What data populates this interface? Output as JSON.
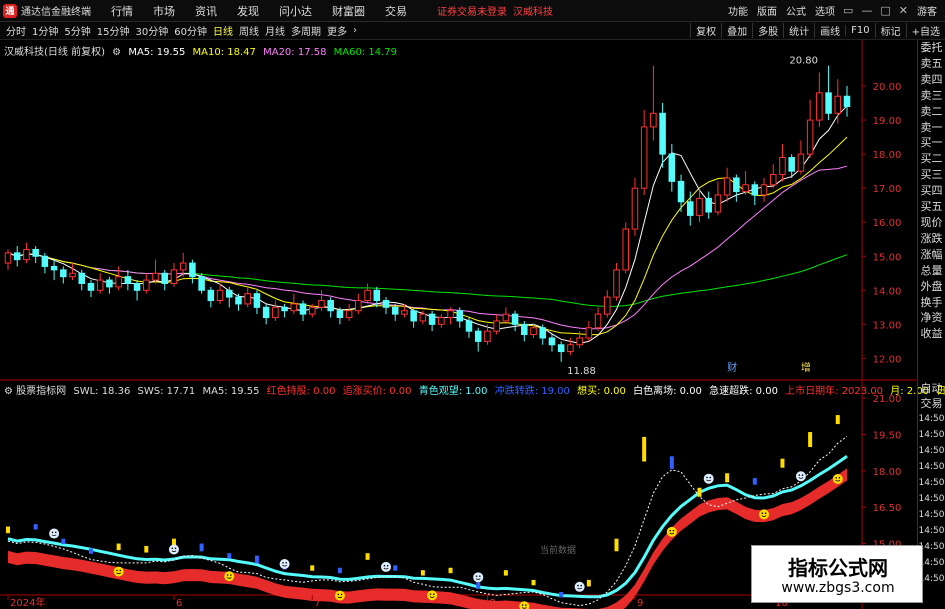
{
  "titlebar": {
    "app_title": "通达信金融终端",
    "logo_glyph": "通",
    "menus": [
      "行情",
      "市场",
      "资讯",
      "发现",
      "问小达",
      "财富圈",
      "交易"
    ],
    "login_notice": "证券交易未登录",
    "stock_name": "汉威科技",
    "right_menus": [
      "功能",
      "版面",
      "公式",
      "选项"
    ],
    "guest": "游客"
  },
  "toolbar": {
    "timeframes": [
      "分时",
      "1分钟",
      "5分钟",
      "15分钟",
      "30分钟",
      "60分钟",
      "日线",
      "周线",
      "月线",
      "多周期",
      "更多"
    ],
    "active_timeframe": "日线",
    "tools": [
      "复权",
      "叠加",
      "多股",
      "统计",
      "画线",
      "F10",
      "标记",
      "+自选"
    ]
  },
  "main_legend": {
    "title": "汉威科技(日线 前复权)",
    "ma5": "MA5: 19.55",
    "ma10": "MA10: 18.47",
    "ma20": "MA20: 17.58",
    "ma60": "MA60: 14.79"
  },
  "main_axis": {
    "ticks": [
      "20.00",
      "19.00",
      "18.00",
      "17.00",
      "16.00",
      "15.00",
      "14.00",
      "13.00",
      "12.00"
    ]
  },
  "main_annotations": {
    "high": "20.80",
    "low": "11.88",
    "marker_cai": "财",
    "marker_zeng": "增"
  },
  "sub_legend": {
    "title": "股票指标网",
    "swl": "SWL: 18.36",
    "sws": "SWS: 17.71",
    "ma5": "MA5: 19.55",
    "red_hold": "红色持股: 0.00",
    "chase": "追涨买价: 0.00",
    "cyan_watch": "青色观望: 1.00",
    "pull_back": "冲跌转跌: 19.00",
    "think_buy": "想买: 0.00",
    "white_leave": "白色离场: 0.00",
    "sharp_drop": "急速超跌: 0.00",
    "list_date": "上市日期年: 2023.00",
    "month": "月: 2.00",
    "day": "日: 17.00"
  },
  "sub_axis": {
    "ticks": [
      "21.00",
      "19.50",
      "18.00",
      "16.50",
      "15.00",
      "13.50"
    ]
  },
  "sub_center_label": "当前数据",
  "date_axis": [
    "2024年",
    "6",
    "7",
    "8",
    "9",
    "10"
  ],
  "right_panel": [
    "委托",
    "卖五",
    "卖四",
    "卖三",
    "卖二",
    "卖一",
    "买一",
    "买二",
    "买三",
    "买四",
    "买五",
    "现价",
    "涨跌",
    "涨幅",
    "总量",
    "外盘",
    "换手",
    "净资",
    "收益"
  ],
  "right_panel2": [
    "自动",
    "交易",
    "14:50",
    "14:50",
    "14:50",
    "14:50",
    "14:50",
    "14:50",
    "14:50",
    "14:50",
    "14:50",
    "14:50",
    "14:50"
  ],
  "watermark": {
    "title": "指标公式网",
    "url": "www.zbgs3.com"
  },
  "colors": {
    "up": "#ff3232",
    "down": "#54fcfc",
    "ma5": "#ffffff",
    "ma10": "#ffff00",
    "ma20": "#ff80ff",
    "ma60": "#00e600",
    "axis": "#b00000"
  },
  "chart_data": {
    "type": "candlestick",
    "ylim": [
      11.6,
      21.0
    ],
    "candles": [
      [
        14.8,
        15.1,
        15.2,
        14.6
      ],
      [
        15.1,
        14.9,
        15.3,
        14.7
      ],
      [
        14.9,
        15.2,
        15.4,
        14.8
      ],
      [
        15.2,
        15.0,
        15.3,
        14.8
      ],
      [
        15.0,
        14.7,
        15.1,
        14.5
      ],
      [
        14.7,
        14.6,
        14.9,
        14.3
      ],
      [
        14.6,
        14.4,
        14.7,
        14.2
      ],
      [
        14.4,
        14.5,
        14.8,
        14.3
      ],
      [
        14.5,
        14.2,
        14.6,
        14.0
      ],
      [
        14.2,
        14.0,
        14.3,
        13.8
      ],
      [
        14.0,
        14.3,
        14.5,
        13.9
      ],
      [
        14.3,
        14.1,
        14.4,
        13.9
      ],
      [
        14.1,
        14.4,
        14.7,
        14.0
      ],
      [
        14.4,
        14.2,
        14.6,
        14.0
      ],
      [
        14.2,
        14.0,
        14.3,
        13.7
      ],
      [
        14.0,
        14.3,
        14.5,
        13.9
      ],
      [
        14.3,
        14.5,
        14.9,
        14.2
      ],
      [
        14.5,
        14.2,
        14.6,
        14.0
      ],
      [
        14.2,
        14.6,
        14.8,
        14.1
      ],
      [
        14.6,
        14.8,
        15.1,
        14.4
      ],
      [
        14.8,
        14.4,
        14.9,
        14.2
      ],
      [
        14.4,
        14.0,
        14.5,
        13.9
      ],
      [
        14.0,
        13.7,
        14.1,
        13.5
      ],
      [
        13.7,
        14.0,
        14.2,
        13.6
      ],
      [
        14.0,
        13.8,
        14.1,
        13.5
      ],
      [
        13.8,
        13.6,
        13.9,
        13.4
      ],
      [
        13.6,
        13.9,
        14.1,
        13.5
      ],
      [
        13.9,
        13.5,
        14.0,
        13.3
      ],
      [
        13.5,
        13.2,
        13.6,
        13.0
      ],
      [
        13.2,
        13.5,
        13.7,
        13.1
      ],
      [
        13.5,
        13.4,
        13.6,
        13.2
      ],
      [
        13.4,
        13.6,
        13.9,
        13.3
      ],
      [
        13.6,
        13.3,
        13.7,
        13.1
      ],
      [
        13.3,
        13.5,
        13.6,
        13.2
      ],
      [
        13.5,
        13.7,
        14.0,
        13.4
      ],
      [
        13.7,
        13.4,
        13.8,
        13.2
      ],
      [
        13.4,
        13.2,
        13.5,
        13.0
      ],
      [
        13.2,
        13.4,
        13.6,
        13.1
      ],
      [
        13.4,
        13.7,
        13.9,
        13.3
      ],
      [
        13.7,
        14.0,
        14.2,
        13.6
      ],
      [
        14.0,
        13.7,
        14.1,
        13.5
      ],
      [
        13.7,
        13.5,
        13.8,
        13.3
      ],
      [
        13.5,
        13.3,
        13.6,
        13.1
      ],
      [
        13.3,
        13.4,
        13.6,
        13.2
      ],
      [
        13.4,
        13.1,
        13.5,
        12.9
      ],
      [
        13.1,
        13.3,
        13.4,
        13.0
      ],
      [
        13.3,
        13.0,
        13.4,
        12.8
      ],
      [
        13.0,
        13.2,
        13.3,
        12.9
      ],
      [
        13.2,
        13.4,
        13.5,
        13.0
      ],
      [
        13.4,
        13.1,
        13.5,
        12.9
      ],
      [
        13.1,
        12.8,
        13.2,
        12.6
      ],
      [
        12.8,
        12.5,
        12.9,
        12.2
      ],
      [
        12.5,
        12.8,
        13.0,
        12.4
      ],
      [
        12.8,
        13.1,
        13.3,
        12.7
      ],
      [
        13.1,
        13.3,
        13.5,
        13.0
      ],
      [
        13.3,
        13.0,
        13.4,
        12.8
      ],
      [
        13.0,
        12.7,
        13.1,
        12.5
      ],
      [
        12.7,
        12.9,
        13.0,
        12.6
      ],
      [
        12.9,
        12.6,
        13.0,
        12.4
      ],
      [
        12.6,
        12.4,
        12.7,
        12.2
      ],
      [
        12.4,
        12.2,
        12.5,
        11.9
      ],
      [
        12.2,
        12.4,
        12.6,
        12.1
      ],
      [
        12.4,
        12.6,
        12.8,
        12.3
      ],
      [
        12.6,
        12.9,
        13.1,
        12.5
      ],
      [
        12.9,
        13.3,
        13.5,
        12.8
      ],
      [
        13.3,
        13.8,
        14.0,
        13.2
      ],
      [
        13.8,
        14.6,
        14.8,
        13.7
      ],
      [
        14.6,
        15.8,
        16.0,
        14.5
      ],
      [
        15.8,
        17.0,
        17.3,
        15.6
      ],
      [
        17.0,
        18.8,
        19.3,
        16.8
      ],
      [
        18.8,
        19.2,
        20.6,
        18.4
      ],
      [
        19.2,
        18.0,
        19.5,
        17.6
      ],
      [
        18.0,
        17.2,
        18.3,
        16.9
      ],
      [
        17.2,
        16.6,
        17.4,
        16.3
      ],
      [
        16.6,
        16.2,
        16.9,
        15.9
      ],
      [
        16.2,
        16.7,
        17.0,
        16.0
      ],
      [
        16.7,
        16.3,
        16.9,
        16.1
      ],
      [
        16.3,
        16.8,
        17.2,
        16.2
      ],
      [
        16.8,
        17.3,
        17.6,
        16.6
      ],
      [
        17.3,
        16.9,
        17.4,
        16.6
      ],
      [
        16.9,
        17.1,
        17.5,
        16.8
      ],
      [
        17.1,
        16.8,
        17.2,
        16.5
      ],
      [
        16.8,
        17.1,
        17.3,
        16.6
      ],
      [
        17.1,
        17.4,
        17.7,
        17.0
      ],
      [
        17.4,
        17.9,
        18.3,
        17.2
      ],
      [
        17.9,
        17.5,
        18.0,
        17.3
      ],
      [
        17.5,
        18.0,
        18.4,
        17.4
      ],
      [
        18.0,
        19.0,
        19.6,
        17.9
      ],
      [
        19.0,
        19.8,
        20.4,
        18.8
      ],
      [
        19.8,
        19.2,
        20.6,
        19.0
      ],
      [
        19.2,
        19.7,
        20.2,
        18.9
      ],
      [
        19.7,
        19.4,
        20.0,
        19.1
      ]
    ],
    "subchart_ylim": [
      13.0,
      21.5
    ]
  }
}
